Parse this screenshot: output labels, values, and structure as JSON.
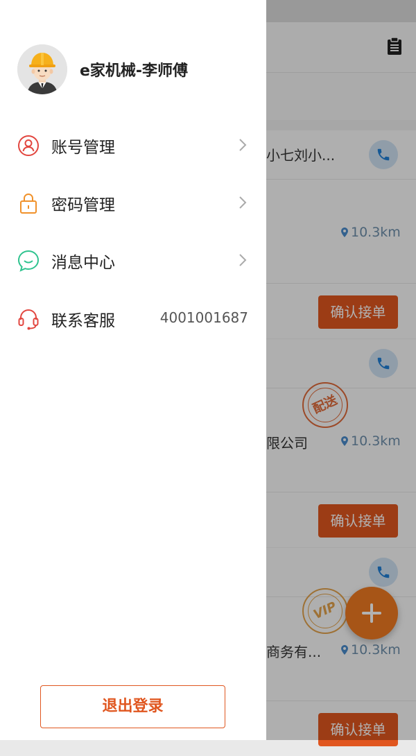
{
  "drawer": {
    "username": "e家机械-李师傅",
    "menu": [
      {
        "label": "账号管理",
        "icon": "user-icon"
      },
      {
        "label": "密码管理",
        "icon": "lock-icon"
      },
      {
        "label": "消息中心",
        "icon": "message-icon"
      },
      {
        "label": "联系客服",
        "icon": "headset-icon",
        "value": "4001001687"
      }
    ],
    "logout_label": "退出登录"
  },
  "background": {
    "orders": [
      {
        "name": "小七刘小...",
        "company": "",
        "distance": "10.3km",
        "button": "确认接单"
      },
      {
        "name": "",
        "company": "限公司",
        "distance": "10.3km",
        "stamp": "配送",
        "button": "确认接单"
      },
      {
        "name": "",
        "company": "商务有...",
        "distance": "10.3km",
        "stamp": "VIP",
        "button": "确认接单"
      }
    ]
  },
  "colors": {
    "accent": "#e0561f",
    "user_icon": "#e2463f",
    "lock_icon": "#f0912a",
    "message_icon": "#2fc38f",
    "headset_icon": "#e2463f",
    "fab": "#f07a22"
  }
}
